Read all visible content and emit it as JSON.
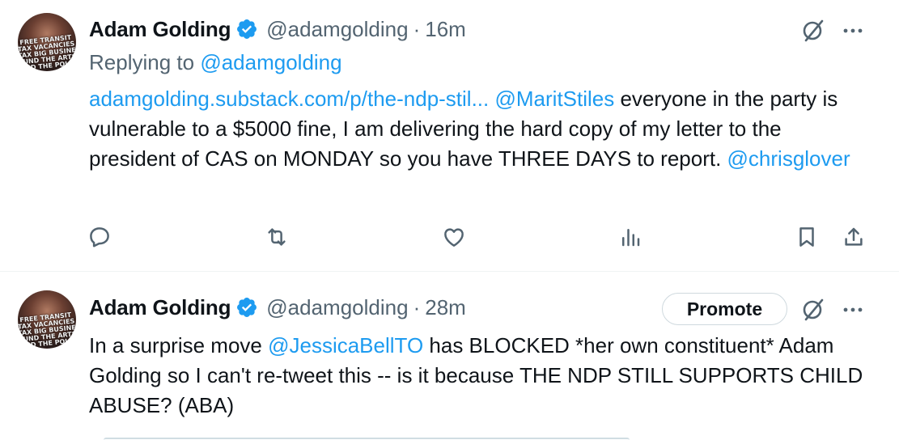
{
  "tweets": [
    {
      "author_name": "Adam Golding",
      "handle": "@adamgolding",
      "separator": "·",
      "time": "16m",
      "replying_prefix": "Replying to",
      "replying_handle": "@adamgolding",
      "body": {
        "link": "adamgolding.substack.com/p/the-ndp-stil...",
        "mention1": "@MaritStiles",
        "text1": " everyone in the party is vulnerable to a $5000 fine, I am delivering the hard copy of my letter to the president of CAS on MONDAY so you have THREE DAYS to report.  ",
        "mention2": "@chrisglover"
      },
      "avatar_text": "FREE TRANSIT\nTAX VACANCIES\nTAX BIG BUSINESS\nFUND THE ARTS\nPAID THE POLICE"
    },
    {
      "author_name": "Adam Golding",
      "handle": "@adamgolding",
      "separator": "·",
      "time": "28m",
      "promote_label": "Promote",
      "body": {
        "text1": "In a surprise move ",
        "mention1": "@JessicaBellTO",
        "text2": " has BLOCKED *her own constituent* Adam Golding so I can't re-tweet this -- is it because THE NDP STILL SUPPORTS CHILD ABUSE? (ABA)"
      },
      "avatar_text": "FREE TRANSIT\nTAX VACANCIES\nTAX BIG BUSINESS\nFUND THE ARTS\nPAID THE POLICE"
    }
  ],
  "icons": {
    "verified": "verified-badge-icon",
    "grok": "grok-icon",
    "more": "more-dots-icon",
    "reply": "reply-icon",
    "repost": "repost-icon",
    "like": "like-icon",
    "views": "views-icon",
    "bookmark": "bookmark-icon",
    "share": "share-icon"
  },
  "colors": {
    "accent": "#1d9bf0",
    "secondary_text": "#536471",
    "primary_text": "#0f1419",
    "verified": "#1d9bf0"
  }
}
